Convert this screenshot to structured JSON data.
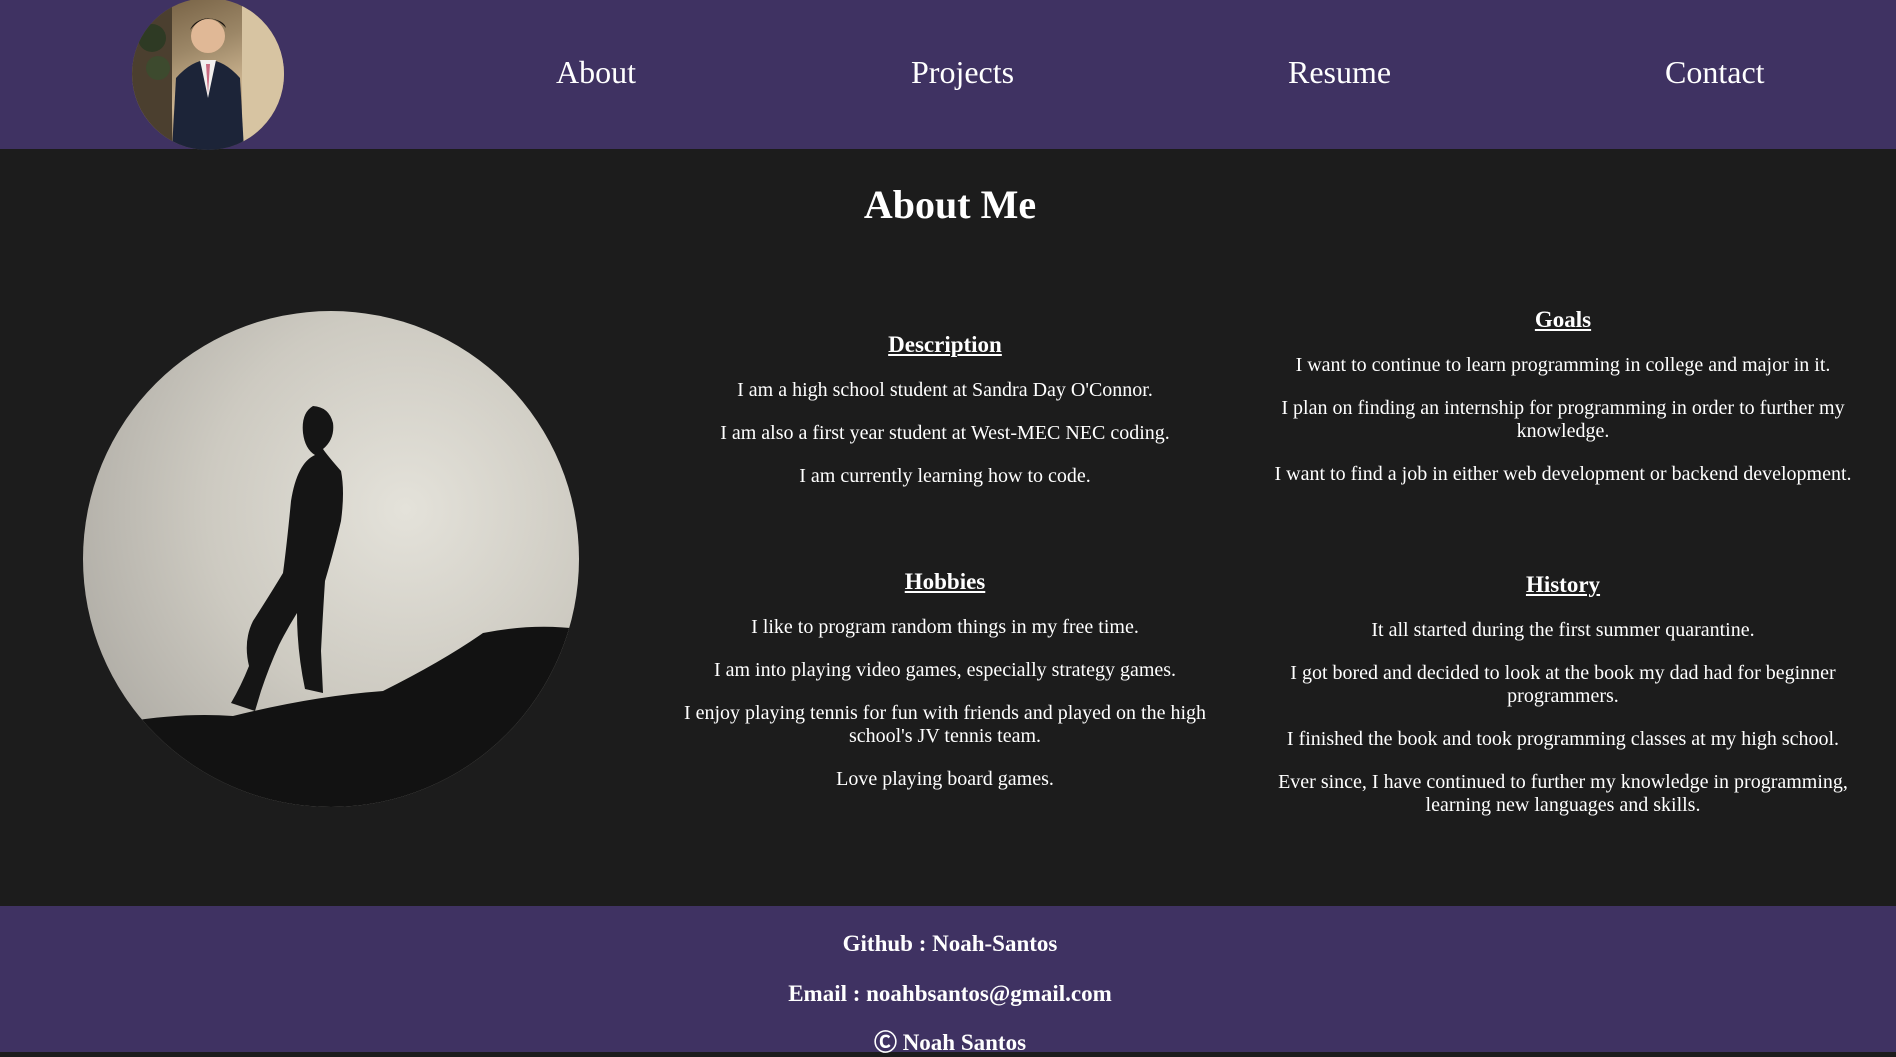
{
  "nav": {
    "items": [
      {
        "label": "About"
      },
      {
        "label": "Projects"
      },
      {
        "label": "Resume"
      },
      {
        "label": "Contact"
      }
    ]
  },
  "main": {
    "title": "About Me",
    "description": {
      "heading": "Description",
      "lines": [
        "I am a high school student at Sandra Day O'Connor.",
        "I am also a first year student at West-MEC NEC coding.",
        "I am currently learning how to code."
      ]
    },
    "hobbies": {
      "heading": "Hobbies",
      "lines": [
        "I like to program random things in my free time.",
        "I am into playing video games, especially strategy games.",
        "I enjoy playing tennis for fun with friends and played on the high school's JV tennis team.",
        "Love playing board games."
      ]
    },
    "goals": {
      "heading": "Goals",
      "lines": [
        "I want to continue to learn programming in college and major in it.",
        "I plan on finding an internship for programming in order to further my knowledge.",
        "I want to find a job in either web development or backend development."
      ]
    },
    "history": {
      "heading": "History",
      "lines": [
        "It all started during the first summer quarantine.",
        "I got bored and decided to look at the book my dad had for beginner programmers.",
        "I finished the book and took programming classes at my high school.",
        "Ever since, I have continued to further my knowledge in programming, learning new languages and skills."
      ]
    }
  },
  "footer": {
    "github": "Github : Noah-Santos",
    "email": "Email : noahbsantos@gmail.com",
    "copyright": "Ⓒ Noah Santos"
  },
  "colors": {
    "header_bg": "#3f3262",
    "body_bg": "#1c1c1c",
    "text": "#ffffff"
  }
}
